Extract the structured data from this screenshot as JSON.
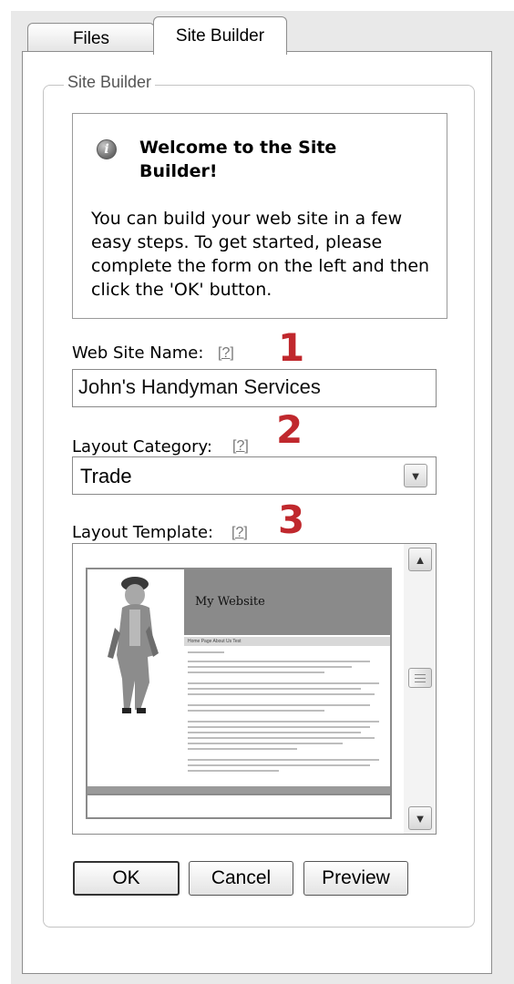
{
  "tabs": {
    "files": "Files",
    "site_builder": "Site Builder"
  },
  "fieldset_legend": "Site Builder",
  "welcome": {
    "title": "Welcome to the Site Builder!",
    "body": "You can build your web site in a few easy steps. To get started, please complete the form on the left and then click the 'OK' button.",
    "icon": "i"
  },
  "site_name": {
    "label": "Web Site Name:",
    "help": "[?]",
    "step": "1",
    "value": "John's Handyman Services"
  },
  "category": {
    "label": "Layout Category:",
    "help": "[?]",
    "step": "2",
    "value": "Trade"
  },
  "template": {
    "label": "Layout Template:",
    "help": "[?]",
    "step": "3",
    "preview_title": "My Website",
    "preview_nav": "Home Page   About Us   Test"
  },
  "buttons": {
    "ok": "OK",
    "cancel": "Cancel",
    "preview": "Preview"
  },
  "colors": {
    "step_number": "#c0282d",
    "panel_bg": "#e9e9e9"
  },
  "icons": {
    "scroll_up": "▲",
    "scroll_down": "▼",
    "dropdown": "▼"
  }
}
